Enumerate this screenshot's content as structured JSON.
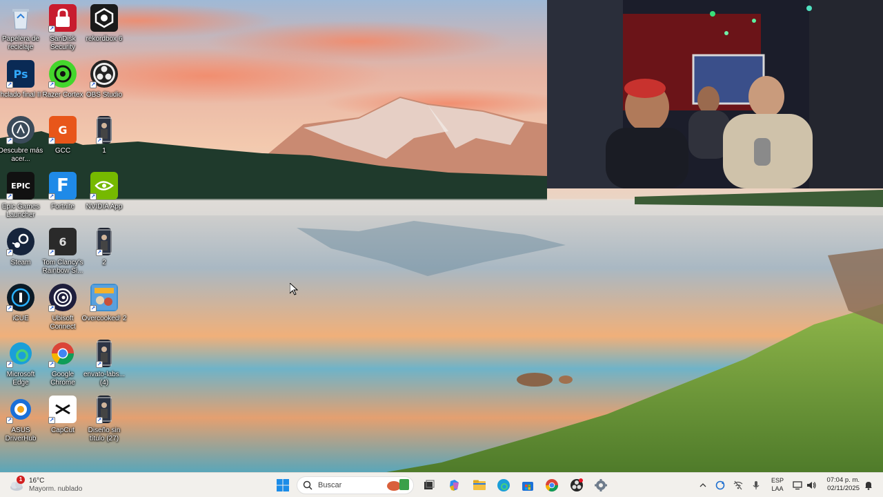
{
  "desktop": {
    "icons": [
      {
        "label": "Papelera de reciclaje",
        "icon": "recycle-bin-icon"
      },
      {
        "label": "SanDisk Security",
        "icon": "lock-icon"
      },
      {
        "label": "rekordbox 6",
        "icon": "rekordbox-icon"
      },
      {
        "label": "hclado final II",
        "icon": "psd-file-icon",
        "text": "Ps"
      },
      {
        "label": "Razer Cortex",
        "icon": "razer-cortex-icon"
      },
      {
        "label": "OBS Studio",
        "icon": "obs-icon"
      },
      {
        "label": "Descubre más acer...",
        "icon": "acer-icon"
      },
      {
        "label": "GCC",
        "icon": "gcc-icon",
        "text": "G"
      },
      {
        "label": "1",
        "icon": "image-file-icon"
      },
      {
        "label": "Epic Games Launcher",
        "icon": "epic-games-icon",
        "text": "EPIC"
      },
      {
        "label": "Fortnite",
        "icon": "fortnite-icon",
        "text": "F"
      },
      {
        "label": "NVIDIA App",
        "icon": "nvidia-icon"
      },
      {
        "label": "Steam",
        "icon": "steam-icon"
      },
      {
        "label": "Tom Clancy's Rainbow Si...",
        "icon": "rainbow-six-icon",
        "text": "6"
      },
      {
        "label": "2",
        "icon": "image-file-icon"
      },
      {
        "label": "iCUE",
        "icon": "icue-icon"
      },
      {
        "label": "Ubisoft Connect",
        "icon": "ubisoft-icon"
      },
      {
        "label": "Overcooked! 2",
        "icon": "overcooked-icon"
      },
      {
        "label": "Microsoft Edge",
        "icon": "edge-icon"
      },
      {
        "label": "Google Chrome",
        "icon": "chrome-icon"
      },
      {
        "label": "envato-labs... (4)",
        "icon": "image-file-icon"
      },
      {
        "label": "ASUS DriverHub",
        "icon": "asus-driverhub-icon"
      },
      {
        "label": "CapCut",
        "icon": "capcut-icon"
      },
      {
        "label": "Diseño sin título (27)",
        "icon": "image-file-icon"
      }
    ]
  },
  "taskbar": {
    "weather": {
      "temp": "16°C",
      "condition": "Mayorm. nublado",
      "badge": "1",
      "icon": "cloud-icon"
    },
    "search_label": "Buscar",
    "pinned": [
      "windows-start-icon",
      "search-icon",
      "widgets-icon",
      "task-view-icon",
      "copilot-icon",
      "file-explorer-icon",
      "edge-icon",
      "microsoft-store-icon",
      "chrome-icon",
      "obs-icon",
      "settings-icon"
    ],
    "tray": {
      "lang_top": "ESP",
      "lang_bottom": "LAA",
      "time": "07:04 p. m.",
      "date": "02/11/2025"
    }
  },
  "colors": {
    "taskbar_bg": "#f2f0ec",
    "accent": "#0078d4"
  }
}
